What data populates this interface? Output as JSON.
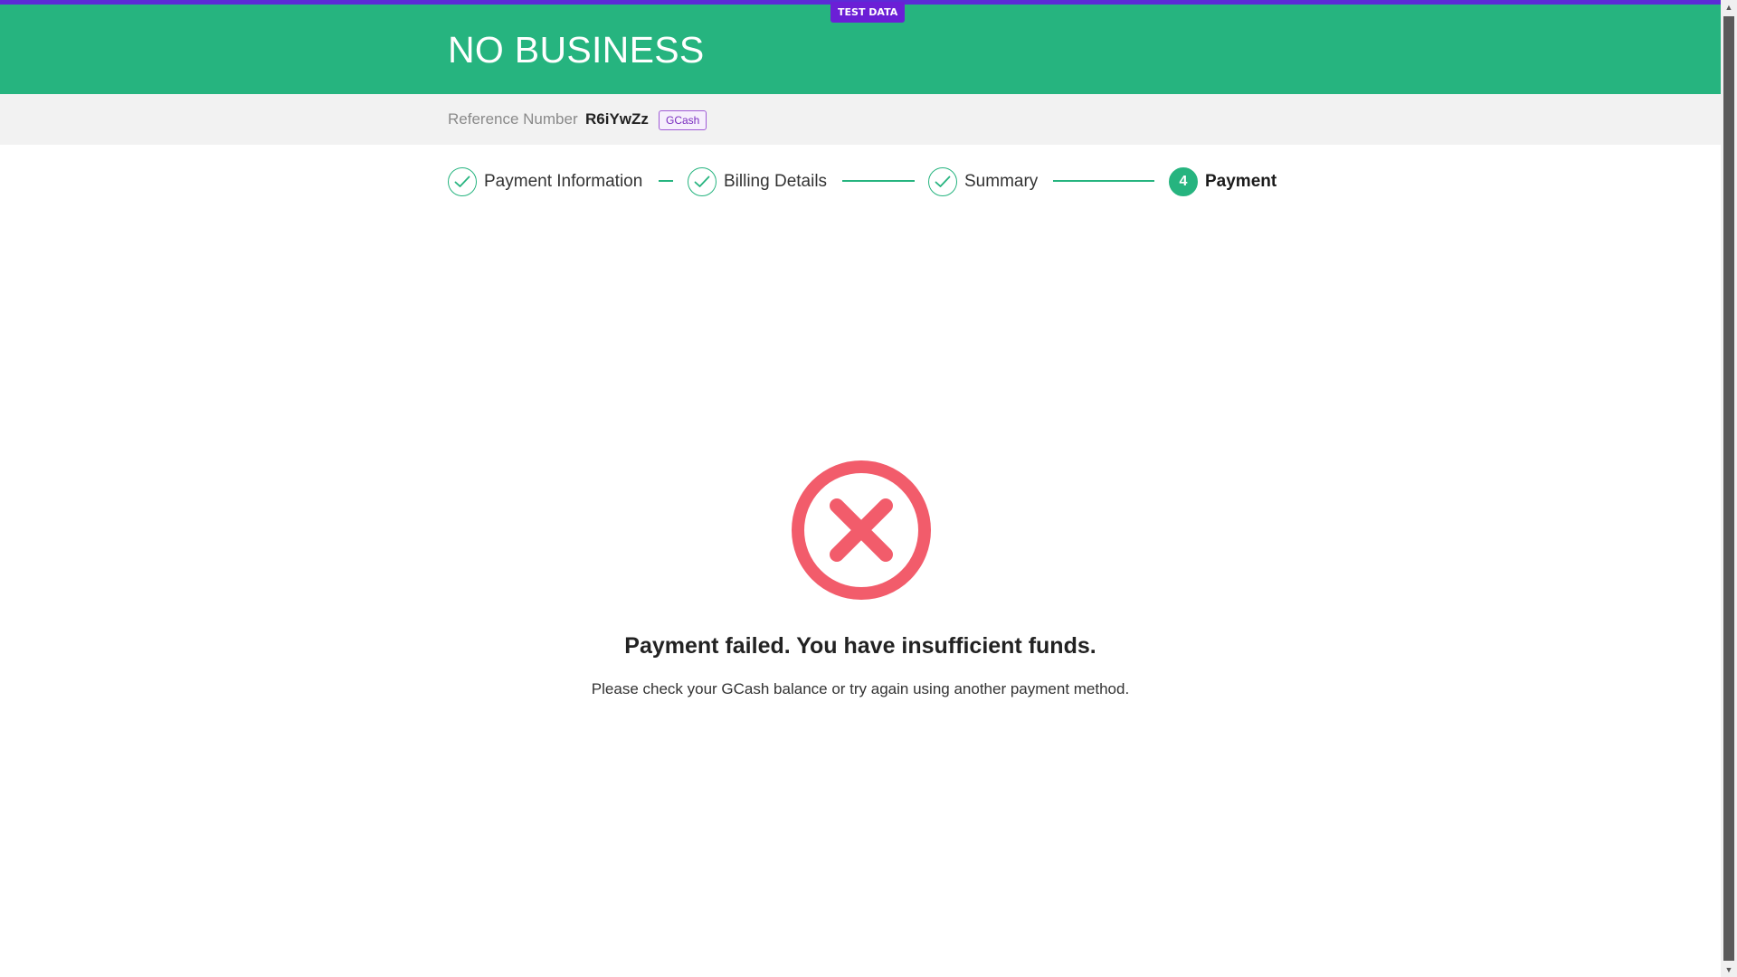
{
  "header": {
    "title": "NO BUSINESS",
    "test_badge": "TEST DATA",
    "accent_color": "#26b47f",
    "badge_color": "#6b1fd6"
  },
  "reference": {
    "label": "Reference Number",
    "value": "R6iYwZz",
    "method_chip": "GCash"
  },
  "stepper": {
    "steps": [
      {
        "label": "Payment Information",
        "state": "done",
        "icon": "check-icon"
      },
      {
        "label": "Billing Details",
        "state": "done",
        "icon": "check-icon"
      },
      {
        "label": "Summary",
        "state": "done",
        "icon": "check-icon"
      },
      {
        "label": "Payment",
        "state": "active",
        "number": "4"
      }
    ]
  },
  "result": {
    "icon": "error-x-icon",
    "icon_color": "#f25c6b",
    "title": "Payment failed. You have insufficient funds.",
    "description": "Please check your GCash balance or try again using another payment method."
  }
}
